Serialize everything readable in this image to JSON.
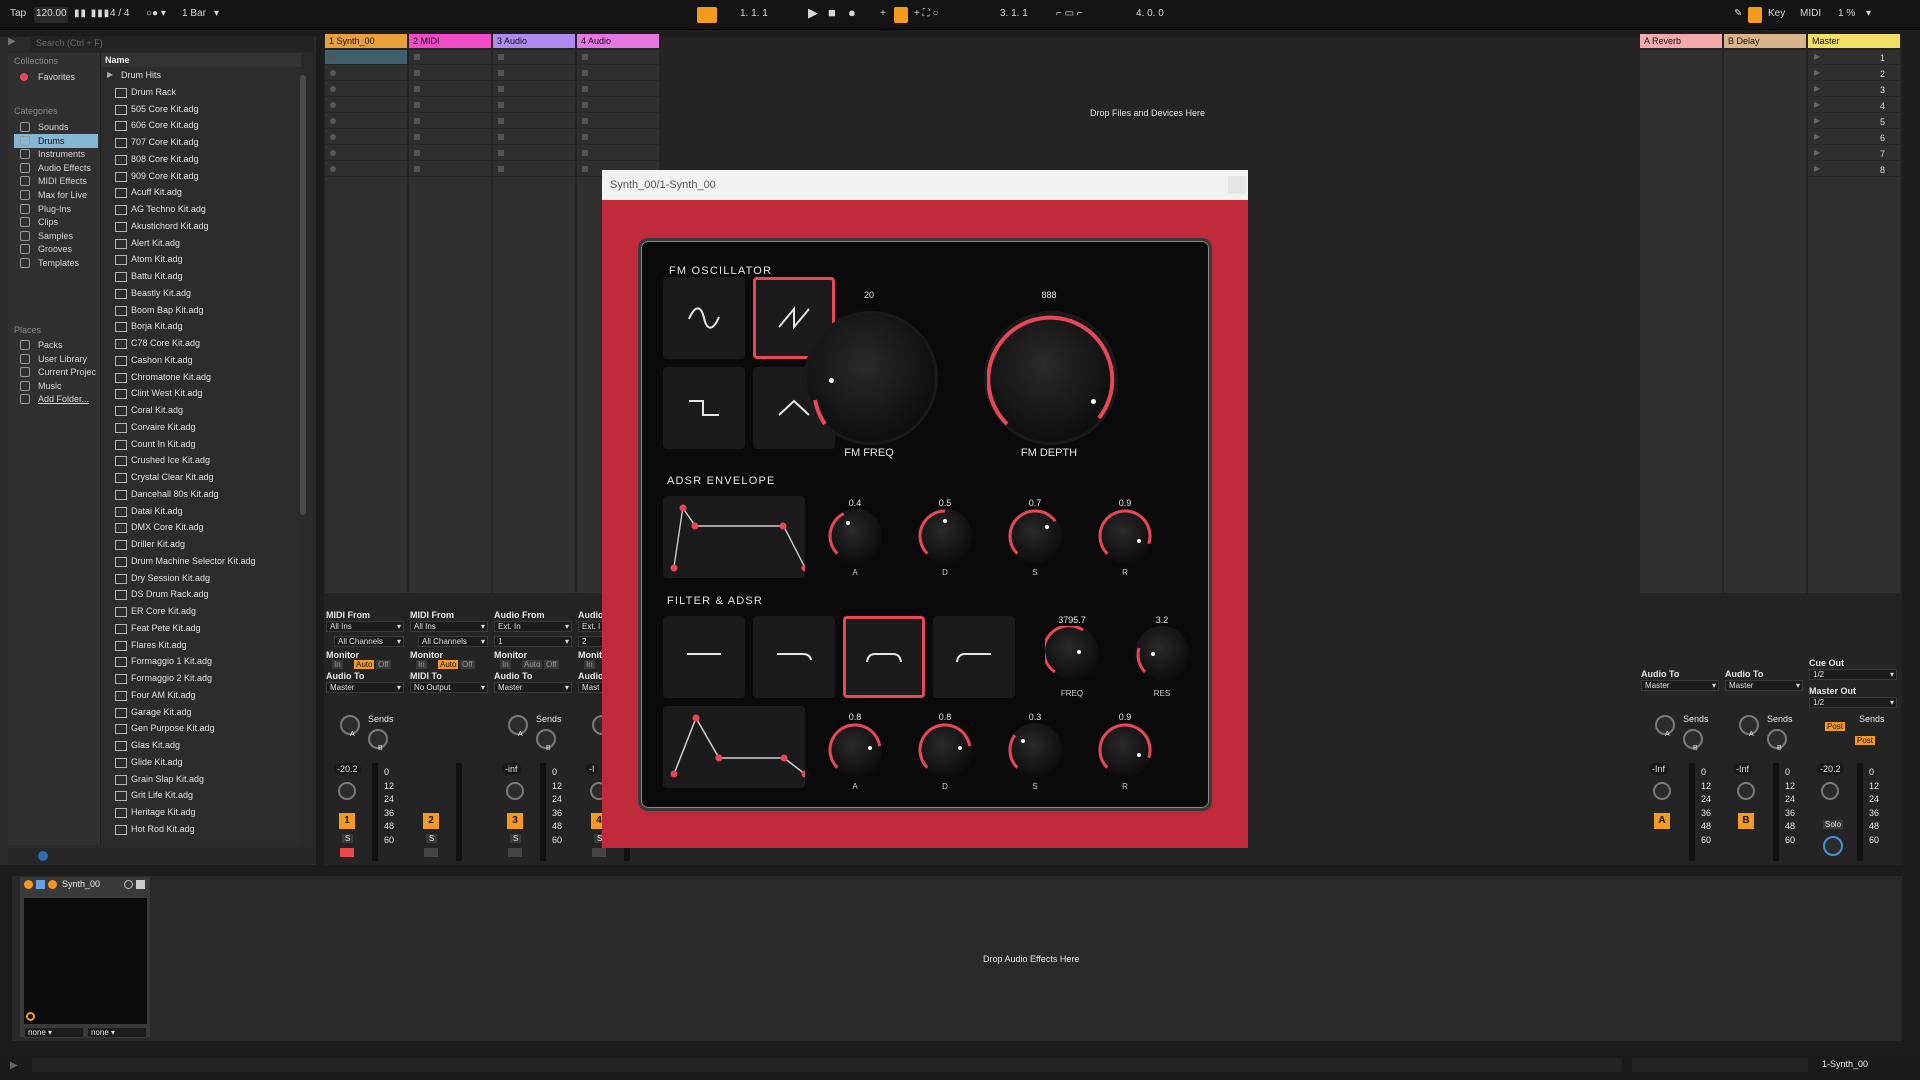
{
  "topbar": {
    "tap": "Tap",
    "tempo": "120.00",
    "signature": "4 / 4",
    "quantize": "1 Bar",
    "position": "1.   1.   1",
    "loop_start": "3.   1.   1",
    "loop_length": "4.   0.   0",
    "key": "Key",
    "midi": "MIDI",
    "cpu": "1 %"
  },
  "browser": {
    "search_placeholder": "Search (Ctrl + F)",
    "collections_header": "Collections",
    "favorites": "Favorites",
    "categories_header": "Categories",
    "categories": [
      "Sounds",
      "Drums",
      "Instruments",
      "Audio Effects",
      "MIDI Effects",
      "Max for Live",
      "Plug-Ins",
      "Clips",
      "Samples",
      "Grooves",
      "Templates"
    ],
    "places_header": "Places",
    "places": [
      "Packs",
      "User Library",
      "Current Projec",
      "Music",
      "Add Folder..."
    ],
    "name_header": "Name",
    "files": [
      "Drum Hits",
      "Drum Rack",
      "505 Core Kit.adg",
      "606 Core Kit.adg",
      "707 Core Kit.adg",
      "808 Core Kit.adg",
      "909 Core Kit.adg",
      "Acuff Kit.adg",
      "AG Techno Kit.adg",
      "Akustichord Kit.adg",
      "Alert Kit.adg",
      "Atom Kit.adg",
      "Battu Kit.adg",
      "Beastly Kit.adg",
      "Boom Bap Kit.adg",
      "Borja Kit.adg",
      "C78 Core Kit.adg",
      "Cashon Kit.adg",
      "Chromatone Kit.adg",
      "Clint West Kit.adg",
      "Coral Kit.adg",
      "Corvaire Kit.adg",
      "Count In Kit.adg",
      "Crushed Ice Kit.adg",
      "Crystal Clear Kit.adg",
      "Dancehall 80s Kit.adg",
      "Datai Kit.adg",
      "DMX Core Kit.adg",
      "Driller Kit.adg",
      "Drum Machine Selector Kit.adg",
      "Dry Session Kit.adg",
      "DS Drum Rack.adg",
      "ER Core Kit.adg",
      "Feat Pete Kit.adg",
      "Flares Kit.adg",
      "Formaggio 1 Kit.adg",
      "Formaggio 2 Kit.adg",
      "Four AM Kit.adg",
      "Garage Kit.adg",
      "Gen Purpose Kit.adg",
      "Glas Kit.adg",
      "Glide Kit.adg",
      "Grain Slap Kit.adg",
      "Grit Life Kit.adg",
      "Heritage Kit.adg",
      "Hot Rod Kit.adg"
    ]
  },
  "tracks": [
    {
      "name": "1 Synth_00",
      "color": "#e8a13a",
      "num": "1",
      "from_label": "MIDI From",
      "from": "All Ins",
      "channel": "All Channels",
      "to_label": "Audio To",
      "to": "Master",
      "vol": "-20.2"
    },
    {
      "name": "2 MIDI",
      "color": "#f14bc8",
      "num": "2",
      "from_label": "MIDI From",
      "from": "All Ins",
      "channel": "All Channels",
      "to_label": "MIDI To",
      "to": "No Output",
      "vol": ""
    },
    {
      "name": "3 Audio",
      "color": "#b08bef",
      "num": "3",
      "from_label": "Audio From",
      "from": "Ext. In",
      "channel": "1",
      "to_label": "Audio To",
      "to": "Master",
      "vol": "-inf"
    },
    {
      "name": "4 Audio",
      "color": "#e577e3",
      "num": "4",
      "from_label": "Audio",
      "from": "Ext. I",
      "channel": "2",
      "to_label": "Audio",
      "to": "Mast",
      "vol": "-I"
    }
  ],
  "returns": [
    {
      "name": "A Reverb",
      "color": "#f3a9a9",
      "letter": "A",
      "to_label": "Audio To",
      "to": "Master",
      "vol": "-Inf"
    },
    {
      "name": "B Delay",
      "color": "#d9b48a",
      "letter": "B",
      "to_label": "Audio To",
      "to": "Master",
      "vol": "-Inf"
    },
    {
      "name": "Master",
      "color": "#f2e066",
      "cue_label": "Cue Out",
      "cue": "1/2",
      "master_label": "Master Out",
      "master_out": "1/2",
      "vol": "-20.2"
    }
  ],
  "mixer": {
    "monitor_label": "Monitor",
    "monitor_in": "In",
    "monitor_auto": "Auto",
    "monitor_off": "Off",
    "sends_label": "Sends",
    "send_a": "A",
    "send_b": "B",
    "solo": "S",
    "post": "Post",
    "solo_master": "Solo",
    "scale": [
      "0",
      "12",
      "24",
      "36",
      "48",
      "60"
    ]
  },
  "drop_files": "Drop Files and Devices Here",
  "scene_numbers": [
    "1",
    "2",
    "3",
    "4",
    "5",
    "6",
    "7",
    "8"
  ],
  "device": {
    "name": "Synth_00",
    "sel1": "none",
    "sel2": "none",
    "drop_audio": "Drop Audio Effects Here"
  },
  "status": {
    "track": "1-Synth_00"
  },
  "plugin": {
    "title": "Synth_00/1-Synth_00",
    "accent": "#e8475a",
    "fm_section": "FM OSCILLATOR",
    "waveforms": [
      "sine-wave-icon",
      "saw-wave-icon",
      "square-wave-icon",
      "triangle-wave-icon"
    ],
    "selected_waveform": "saw",
    "fm_freq": {
      "label": "FM FREQ",
      "value": "20"
    },
    "fm_depth": {
      "label": "FM DEPTH",
      "value": "888"
    },
    "adsr_section": "ADSR ENVELOPE",
    "adsr": [
      {
        "label": "A",
        "value": "0.4"
      },
      {
        "label": "D",
        "value": "0.5"
      },
      {
        "label": "S",
        "value": "0.7"
      },
      {
        "label": "R",
        "value": "0.9"
      }
    ],
    "filter_section": "FILTER & ADSR",
    "filter_types": [
      "flat-filter-icon",
      "lowpass-filter-icon",
      "bandpass-filter-icon",
      "highpass-filter-icon"
    ],
    "selected_filter": "bandpass",
    "freq": {
      "label": "FREQ",
      "value": "3795.7"
    },
    "res": {
      "label": "RES",
      "value": "3.2"
    },
    "fadsr": [
      {
        "label": "A",
        "value": "0.8"
      },
      {
        "label": "D",
        "value": "0.8"
      },
      {
        "label": "S",
        "value": "0.3"
      },
      {
        "label": "R",
        "value": "0.9"
      }
    ]
  }
}
